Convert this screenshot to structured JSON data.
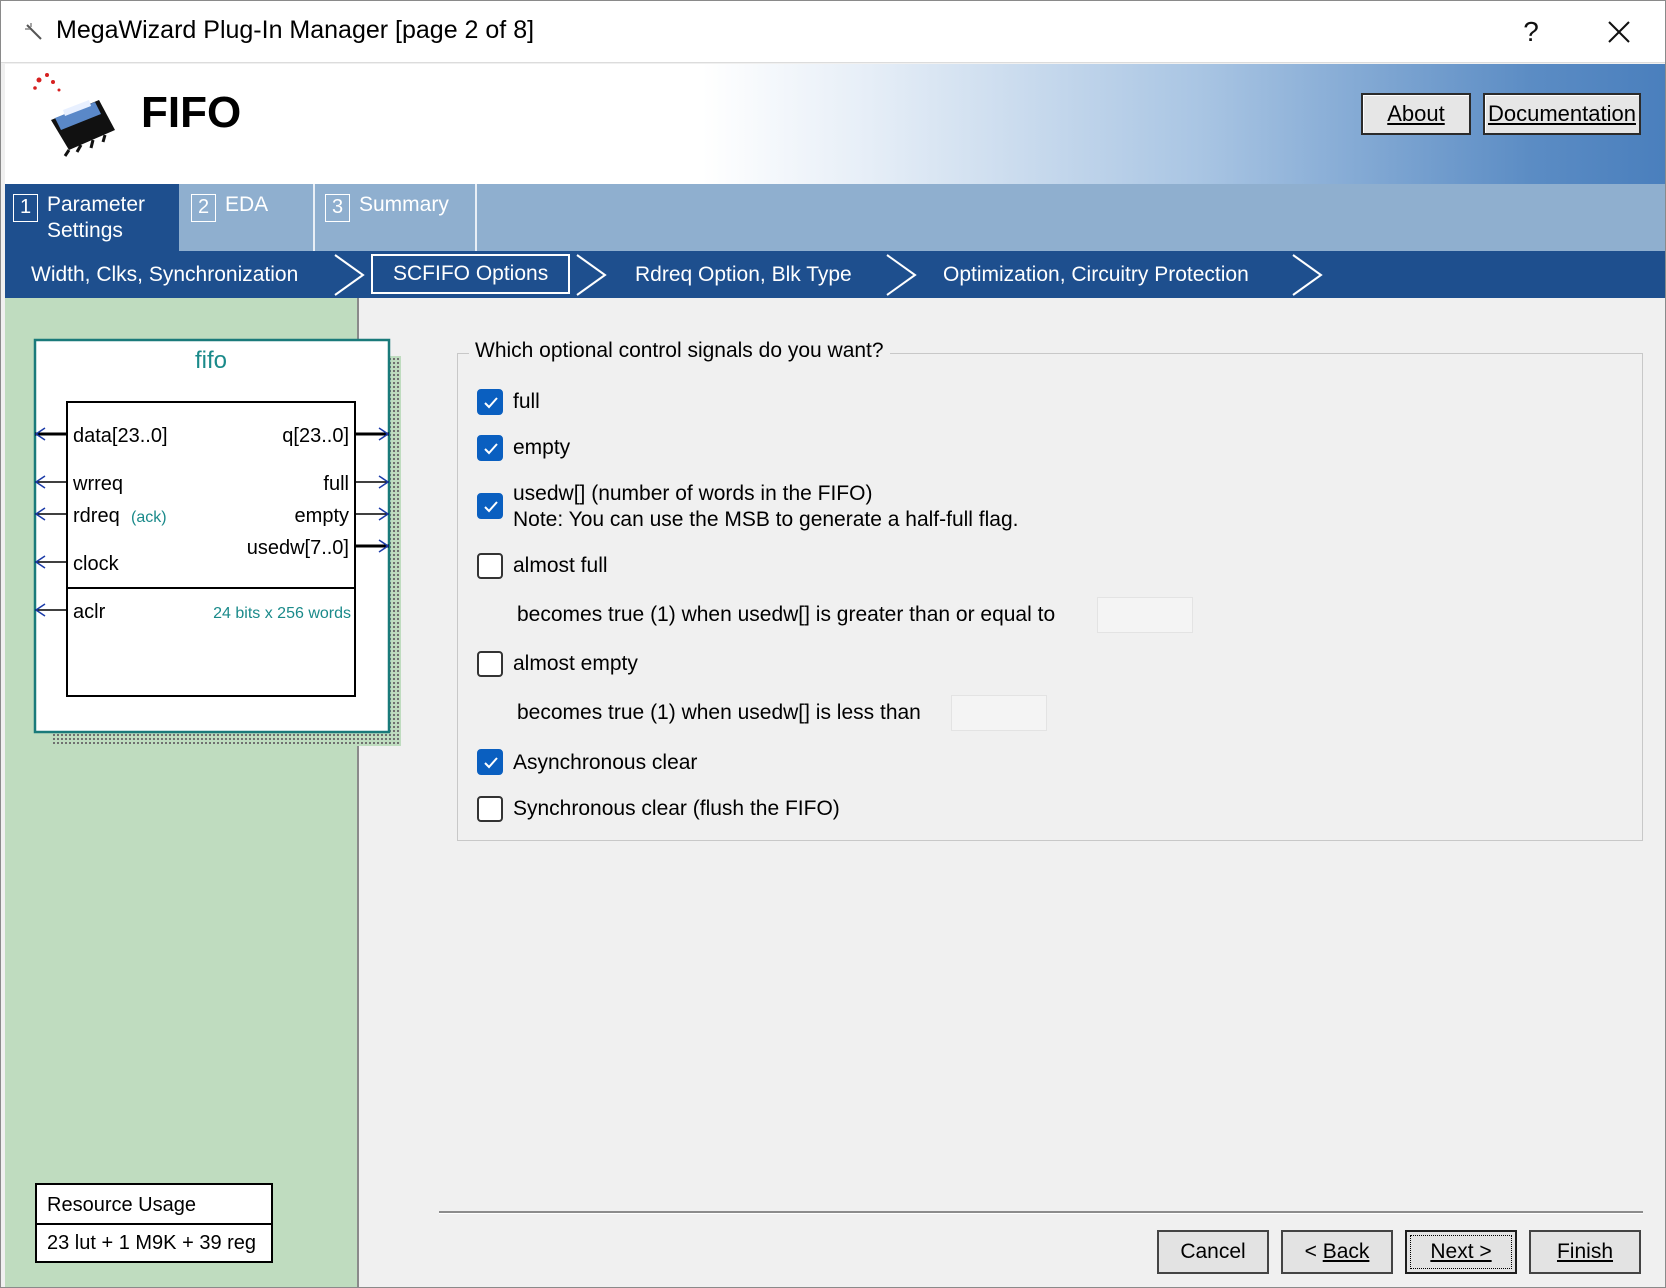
{
  "window": {
    "title": "MegaWizard Plug-In Manager [page 2 of 8]",
    "help_label": "?",
    "close_label": "×"
  },
  "banner": {
    "title": "FIFO",
    "about_label": "About",
    "documentation_label": "Documentation"
  },
  "steps": [
    {
      "num": "1",
      "label": "Parameter",
      "label2": "Settings",
      "active": true
    },
    {
      "num": "2",
      "label": "EDA"
    },
    {
      "num": "3",
      "label": "Summary"
    }
  ],
  "breadcrumb": [
    {
      "label": "Width, Clks, Synchronization"
    },
    {
      "label": "SCFIFO Options",
      "selected": true
    },
    {
      "label": "Rdreq Option, Blk Type"
    },
    {
      "label": "Optimization, Circuitry Protection"
    }
  ],
  "symbol": {
    "name": "fifo",
    "inputs": [
      "data[23..0]",
      "wrreq",
      "rdreq",
      "clock",
      "aclr"
    ],
    "rdreq_note": "(ack)",
    "outputs": [
      "q[23..0]",
      "full",
      "empty",
      "usedw[7..0]"
    ],
    "size_note": "24 bits x 256 words"
  },
  "resource": {
    "title": "Resource Usage",
    "value": "23 lut + 1 M9K + 39 reg"
  },
  "options": {
    "question": "Which optional control signals do you want?",
    "full": {
      "label": "full",
      "checked": true
    },
    "empty": {
      "label": "empty",
      "checked": true
    },
    "usedw": {
      "label": "usedw[]  (number of words in the FIFO)",
      "note": "Note: You can use the MSB to generate a half-full flag.",
      "checked": true
    },
    "almost_full": {
      "label": "almost full",
      "checked": false,
      "sub": "becomes true (1) when usedw[] is greater than or equal to",
      "value": ""
    },
    "almost_empty": {
      "label": "almost empty",
      "checked": false,
      "sub": "becomes true (1) when usedw[] is less than",
      "value": ""
    },
    "async_clear": {
      "label": "Asynchronous clear",
      "checked": true
    },
    "sync_clear": {
      "label": "Synchronous clear (flush the FIFO)",
      "checked": false
    }
  },
  "buttons": {
    "cancel": "Cancel",
    "back_prefix": "< ",
    "back": "Back",
    "next": "Next >",
    "finish": "Finish"
  },
  "colors": {
    "nav_blue": "#1e4f8e",
    "panel_green": "#bfdcbf",
    "checkbox_blue": "#0a5fc0"
  }
}
